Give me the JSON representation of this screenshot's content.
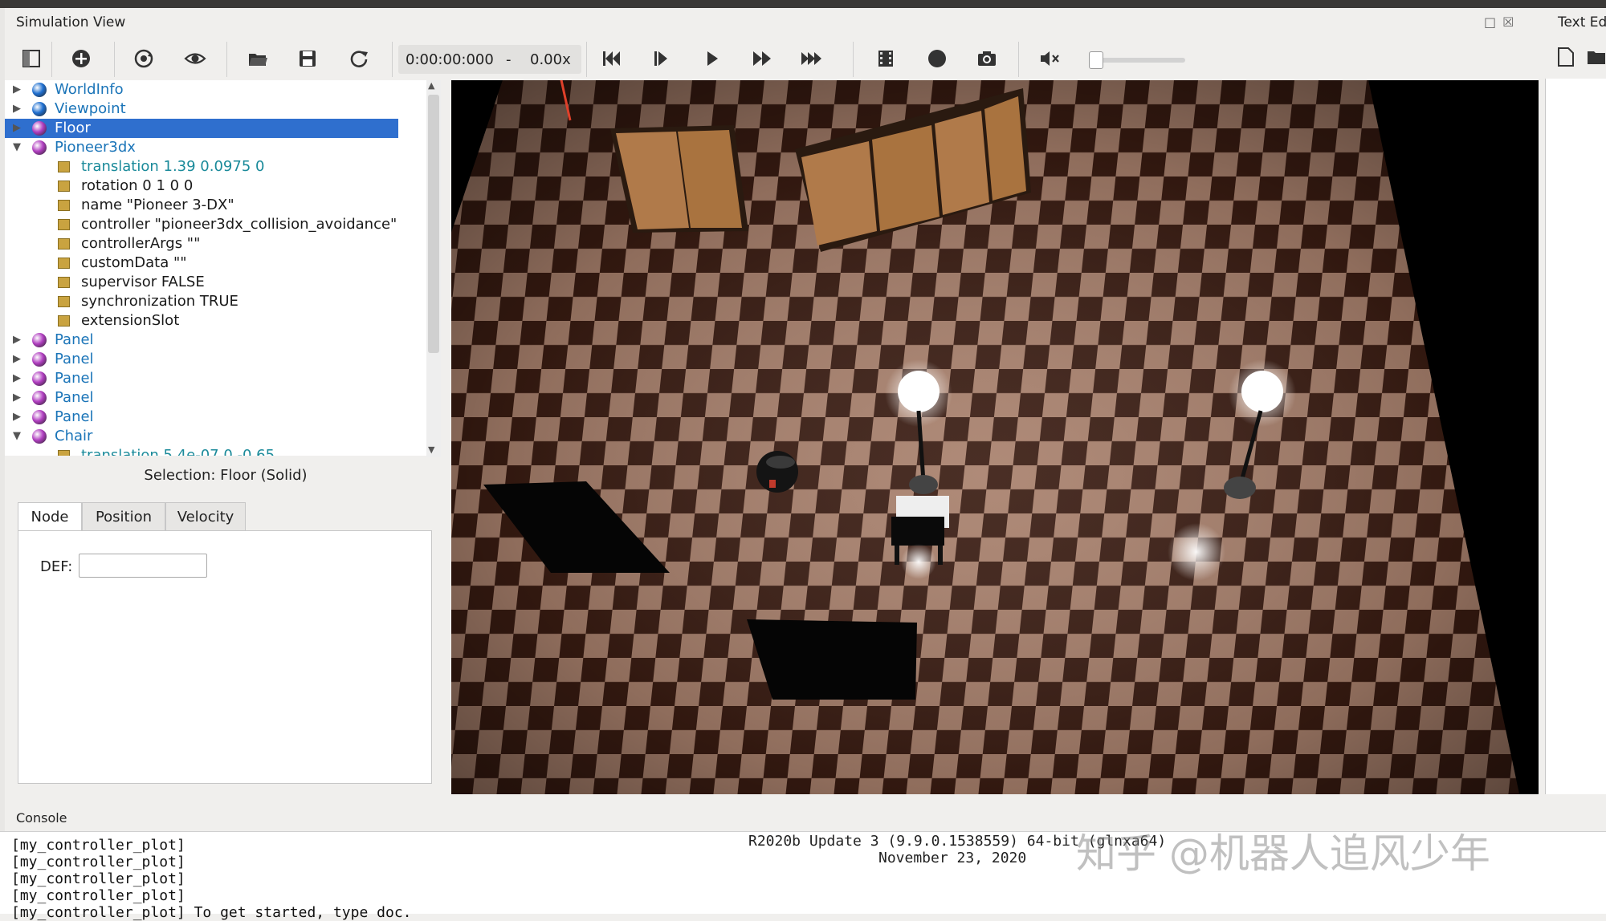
{
  "window": {
    "sim_title": "Simulation View",
    "text_editor_title": "Text Edi"
  },
  "toolbar": {
    "time": "0:00:00:000",
    "time_separator": "-",
    "speed": "0.00x",
    "buttons": [
      "toggle-scene-tree",
      "add-node",
      "reset-view",
      "view-visibility",
      "open-world",
      "save-world",
      "reload-world",
      "step-back",
      "step",
      "run",
      "fast",
      "fastest",
      "record-movie",
      "record",
      "screenshot",
      "mute"
    ]
  },
  "scene_tree": {
    "items": [
      {
        "label": "WorldInfo",
        "kind": "node",
        "ball": "#1f6fd0"
      },
      {
        "label": "Viewpoint",
        "kind": "node",
        "ball": "#1f6fd0"
      },
      {
        "label": "Floor",
        "kind": "node",
        "ball": "#b03ec0",
        "selected": true
      },
      {
        "label": "Pioneer3dx",
        "kind": "node",
        "ball": "#b03ec0",
        "expanded": true
      },
      {
        "label": "translation 1.39 0.0975 0",
        "kind": "fieldmod"
      },
      {
        "label": "rotation 0 1 0 0",
        "kind": "field"
      },
      {
        "label": "name \"Pioneer 3-DX\"",
        "kind": "field"
      },
      {
        "label": "controller \"pioneer3dx_collision_avoidance\"",
        "kind": "field"
      },
      {
        "label": "controllerArgs \"\"",
        "kind": "field"
      },
      {
        "label": "customData \"\"",
        "kind": "field"
      },
      {
        "label": "supervisor FALSE",
        "kind": "field"
      },
      {
        "label": "synchronization TRUE",
        "kind": "field"
      },
      {
        "label": "extensionSlot",
        "kind": "field"
      },
      {
        "label": "Panel",
        "kind": "node",
        "ball": "#b03ec0"
      },
      {
        "label": "Panel",
        "kind": "node",
        "ball": "#b03ec0"
      },
      {
        "label": "Panel",
        "kind": "node",
        "ball": "#b03ec0"
      },
      {
        "label": "Panel",
        "kind": "node",
        "ball": "#b03ec0"
      },
      {
        "label": "Panel",
        "kind": "node",
        "ball": "#b03ec0"
      },
      {
        "label": "Chair",
        "kind": "node",
        "ball": "#b03ec0",
        "expanded": true
      },
      {
        "label": "translation 5.4e-07 0 -0.65",
        "kind": "fieldmod"
      }
    ]
  },
  "selection": {
    "label": "Selection: Floor (Solid)",
    "tabs": [
      "Node",
      "Position",
      "Velocity"
    ],
    "active_tab": "Node",
    "def_label": "DEF:",
    "def_value": ""
  },
  "console": {
    "label": "Console",
    "lines": [
      "[my_controller_plot]",
      "[my_controller_plot]",
      "[my_controller_plot]",
      "[my_controller_plot]",
      "[my_controller_plot] To get started, type doc."
    ],
    "version_line1": "R2020b Update 3 (9.9.0.1538559) 64-bit (glnxa64)",
    "version_line2": "November 23, 2020"
  },
  "watermark": "知乎 @机器人追风少年",
  "colors": {
    "selection": "#2f6fce",
    "node_text": "#1a74b8",
    "field_mod_text": "#1a8a9a",
    "floor_dark": "#3a1c12",
    "floor_light": "#a8806c"
  }
}
